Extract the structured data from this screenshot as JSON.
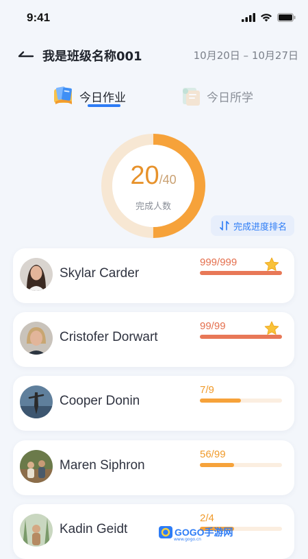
{
  "status": {
    "time": "9:41"
  },
  "header": {
    "class_name": "我是班级名称001",
    "date_range": "10月20日 – 10月27日"
  },
  "tabs": [
    {
      "label": "今日作业",
      "active": true
    },
    {
      "label": "今日所学",
      "active": false
    }
  ],
  "summary": {
    "completed": "20",
    "total": "/40",
    "label": "完成人数",
    "progress": 0.5
  },
  "sort_button": {
    "label": "完成进度排名"
  },
  "students": [
    {
      "name": "Skylar Carder",
      "progress": "999/999",
      "ratio": 1.0,
      "starred": true,
      "avatar": "avatar-1"
    },
    {
      "name": "Cristofer Dorwart",
      "progress": "99/99",
      "ratio": 1.0,
      "starred": true,
      "avatar": "avatar-2"
    },
    {
      "name": "Cooper Donin",
      "progress": "7/9",
      "ratio": 0.5,
      "starred": false,
      "avatar": "avatar-3"
    },
    {
      "name": "Maren Siphron",
      "progress": "56/99",
      "ratio": 0.42,
      "starred": false,
      "avatar": "avatar-4"
    },
    {
      "name": "Kadin Geidt",
      "progress": "2/4",
      "ratio": 0.42,
      "starred": false,
      "avatar": "avatar-5"
    }
  ],
  "watermark": {
    "brand": "GOGO手游网",
    "domain": "www.gogo.cn"
  },
  "colors": {
    "accent": "#2d7cf6",
    "ring": "#f6a23a",
    "ring_track": "#f7e7d3",
    "done": "#e87857",
    "partial": "#f6a23a"
  }
}
